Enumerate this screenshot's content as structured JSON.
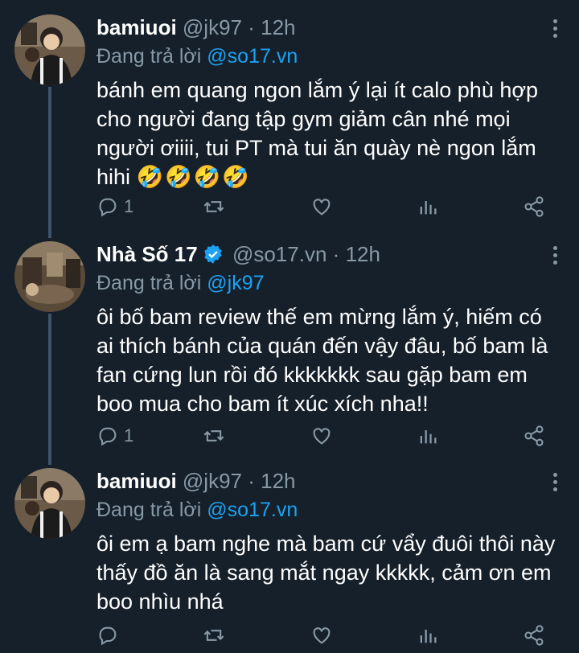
{
  "tweets": [
    {
      "name": "bamiuoi",
      "handle": "@jk97",
      "sep": "·",
      "time": "12h",
      "verified": false,
      "reply_prefix": "Đang trả lời",
      "reply_to": "@so17.vn",
      "text_lines": [
        "bánh em quang ngon lắm ý lại ít calo phù hợp",
        "cho người đang tập gym giảm cân nhé mọi",
        "người ơiiii, tui PT mà tui ăn quày nè ngon lắm",
        "hihi"
      ],
      "emoji": "🤣🤣🤣🤣",
      "reply_count": "1",
      "retweet_count": "",
      "like_count": ""
    },
    {
      "name": "Nhà Số 17",
      "handle": "@so17.vn",
      "sep": "·",
      "time": "12h",
      "verified": true,
      "reply_prefix": "Đang trả lời",
      "reply_to": "@jk97",
      "text_lines": [
        "ôi bố bam review thế em mừng lắm ý, hiếm có",
        "ai thích bánh của quán đến vậy đâu, bố bam là",
        "fan cứng lun rồi đó kkkkkkk sau gặp bam em",
        "boo mua cho bam ít xúc xích nha!!"
      ],
      "reply_count": "1",
      "retweet_count": "",
      "like_count": ""
    },
    {
      "name": "bamiuoi",
      "handle": "@jk97",
      "sep": "·",
      "time": "12h",
      "verified": false,
      "reply_prefix": "Đang trả lời",
      "reply_to": "@so17.vn",
      "text_lines": [
        "ôi em ạ bam nghe mà bam cứ vẩy đuôi thôi này",
        "thấy đồ ăn là sang mắt ngay kkkkk, cảm ơn em",
        "boo nhìu nhá"
      ],
      "reply_count": "",
      "retweet_count": "",
      "like_count": ""
    }
  ],
  "icons": {
    "reply": "reply-icon",
    "retweet": "retweet-icon",
    "like": "heart-icon",
    "analytics": "analytics-icon",
    "share": "share-icon",
    "more": "more-icon",
    "verified": "verified-badge-icon"
  },
  "colors": {
    "background": "#15202b",
    "secondary_text": "#8899a6",
    "link": "#1da1f2",
    "thread_line": "#3d5466"
  }
}
